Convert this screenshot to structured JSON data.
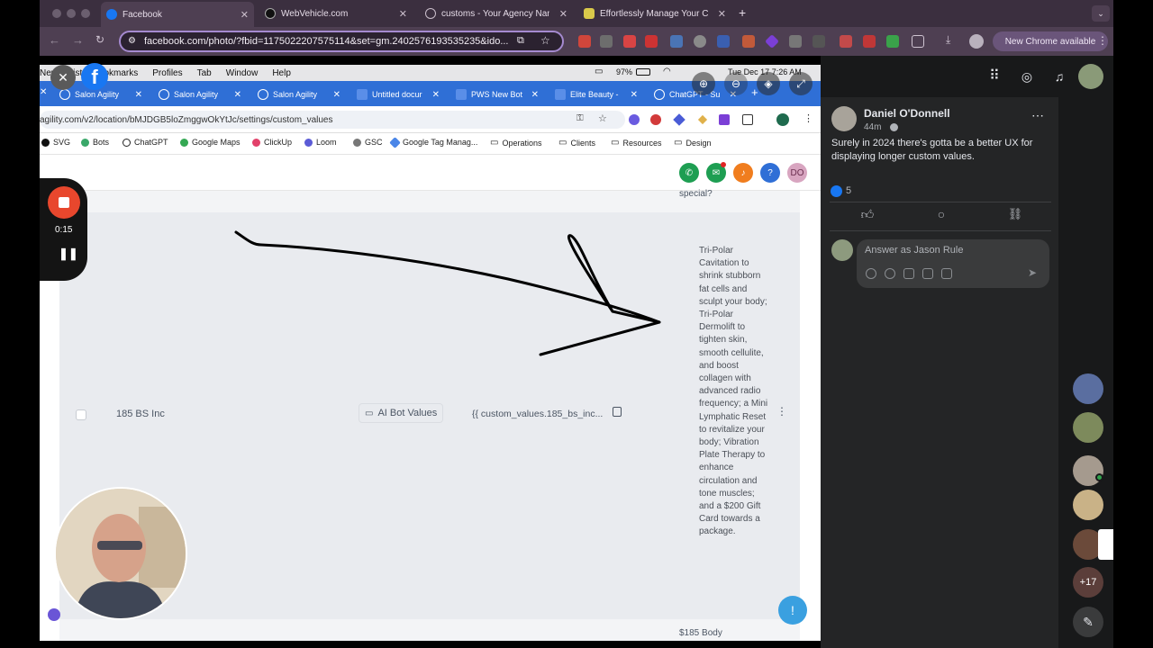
{
  "browser": {
    "tabs": [
      {
        "label": "Facebook",
        "icon": "facebook-icon"
      },
      {
        "label": "WebVehicle.com",
        "icon": "webvehicle-icon"
      },
      {
        "label": "customs - Your Agency Name",
        "icon": "globe-icon"
      },
      {
        "label": "Effortlessly Manage Your Cu",
        "icon": "shield-icon"
      }
    ],
    "url": "facebook.com/photo/?fbid=1175022207575114&set=gm.2402576193535235&ido...",
    "new_chrome_label": "New Chrome available"
  },
  "shared_screen": {
    "mac_menu": {
      "items": [
        "New",
        "Hist",
        "Bookmarks",
        "Profiles",
        "Tab",
        "Window",
        "Help"
      ],
      "battery": "97%",
      "clock": "Tue Dec 17  7:26 AM"
    },
    "inner_tabs": [
      {
        "label": "Salon Agility"
      },
      {
        "label": "Salon Agility"
      },
      {
        "label": "Salon Agility"
      },
      {
        "label": "Untitled docur"
      },
      {
        "label": "PWS New Bot"
      },
      {
        "label": "Elite Beauty -"
      },
      {
        "label": "ChatGPT - Su"
      }
    ],
    "inner_url": "agility.com/v2/location/bMJDGB5loZmggwOkYtJc/settings/custom_values",
    "bookmarks": [
      "SVG",
      "Bots",
      "ChatGPT",
      "Google Maps",
      "ClickUp",
      "Loom",
      "GSC",
      "Google Tag Manag...",
      "Operations",
      "Clients",
      "Resources",
      "Design"
    ],
    "header_avatar": "DO",
    "row": {
      "name": "185 BS Inc",
      "folder": "AI Bot Values",
      "key": "{{ custom_values.185_bs_inc...",
      "above_text": "special?",
      "description": "Tri-Polar Cavitation to shrink stubborn fat cells and sculpt your body; Tri-Polar Dermolift to tighten skin, smooth cellulite, and boost collagen with advanced radio frequency; a Mini Lymphatic Reset to revitalize your body; Vibration Plate Therapy to enhance circulation and tone muscles; and a $200 Gift Card towards a package.",
      "next_row_text": "$185 Body"
    }
  },
  "recorder": {
    "time": "0:15"
  },
  "post": {
    "author": "Daniel O'Donnell",
    "time_ago": "44m",
    "text": "Surely in 2024 there's gotta be a better UX for displaying longer custom values.",
    "likes": "5",
    "comment_placeholder": "Answer as Jason Rule"
  },
  "rail": {
    "more_count": "+17"
  },
  "colors": {
    "accent": "#2f6fd6",
    "facebook_bg": "#242526",
    "browser_tab_bg": "#3b2f3f"
  }
}
